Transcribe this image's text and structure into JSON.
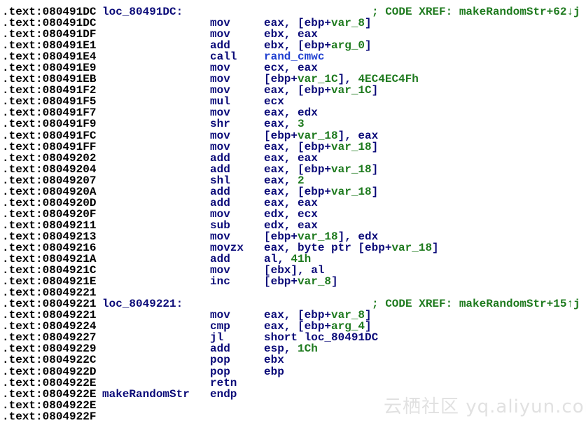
{
  "colors": {
    "address": "#000000",
    "instruction": "#0a0a78",
    "name_or_number": "#1e7a1e",
    "function_call": "#1f3fd0"
  },
  "watermark": "云栖社区 yq.aliyun.com",
  "lines": [
    {
      "addr": ".text:080491DC",
      "label": "loc_80491DC:",
      "mn": "",
      "ops": [],
      "cmt": "; CODE XREF: makeRandomStr+62↓j"
    },
    {
      "addr": ".text:080491DC",
      "label": "",
      "mn": "mov",
      "ops": [
        [
          "eax, [ebp+",
          "n"
        ],
        [
          "var_8",
          "g"
        ],
        [
          "]",
          "n"
        ]
      ],
      "cmt": ""
    },
    {
      "addr": ".text:080491DF",
      "label": "",
      "mn": "mov",
      "ops": [
        [
          "ebx, eax",
          "n"
        ]
      ],
      "cmt": ""
    },
    {
      "addr": ".text:080491E1",
      "label": "",
      "mn": "add",
      "ops": [
        [
          "ebx, [ebp+",
          "n"
        ],
        [
          "arg_0",
          "g"
        ],
        [
          "]",
          "n"
        ]
      ],
      "cmt": ""
    },
    {
      "addr": ".text:080491E4",
      "label": "",
      "mn": "call",
      "ops": [
        [
          "rand_cmwc",
          "b"
        ]
      ],
      "cmt": ""
    },
    {
      "addr": ".text:080491E9",
      "label": "",
      "mn": "mov",
      "ops": [
        [
          "ecx, eax",
          "n"
        ]
      ],
      "cmt": ""
    },
    {
      "addr": ".text:080491EB",
      "label": "",
      "mn": "mov",
      "ops": [
        [
          "[ebp+",
          "n"
        ],
        [
          "var_1C",
          "g"
        ],
        [
          "], ",
          "n"
        ],
        [
          "4EC4EC4Fh",
          "g"
        ]
      ],
      "cmt": ""
    },
    {
      "addr": ".text:080491F2",
      "label": "",
      "mn": "mov",
      "ops": [
        [
          "eax, [ebp+",
          "n"
        ],
        [
          "var_1C",
          "g"
        ],
        [
          "]",
          "n"
        ]
      ],
      "cmt": ""
    },
    {
      "addr": ".text:080491F5",
      "label": "",
      "mn": "mul",
      "ops": [
        [
          "ecx",
          "n"
        ]
      ],
      "cmt": ""
    },
    {
      "addr": ".text:080491F7",
      "label": "",
      "mn": "mov",
      "ops": [
        [
          "eax, edx",
          "n"
        ]
      ],
      "cmt": ""
    },
    {
      "addr": ".text:080491F9",
      "label": "",
      "mn": "shr",
      "ops": [
        [
          "eax, ",
          "n"
        ],
        [
          "3",
          "g"
        ]
      ],
      "cmt": ""
    },
    {
      "addr": ".text:080491FC",
      "label": "",
      "mn": "mov",
      "ops": [
        [
          "[ebp+",
          "n"
        ],
        [
          "var_18",
          "g"
        ],
        [
          "], eax",
          "n"
        ]
      ],
      "cmt": ""
    },
    {
      "addr": ".text:080491FF",
      "label": "",
      "mn": "mov",
      "ops": [
        [
          "eax, [ebp+",
          "n"
        ],
        [
          "var_18",
          "g"
        ],
        [
          "]",
          "n"
        ]
      ],
      "cmt": ""
    },
    {
      "addr": ".text:08049202",
      "label": "",
      "mn": "add",
      "ops": [
        [
          "eax, eax",
          "n"
        ]
      ],
      "cmt": ""
    },
    {
      "addr": ".text:08049204",
      "label": "",
      "mn": "add",
      "ops": [
        [
          "eax, [ebp+",
          "n"
        ],
        [
          "var_18",
          "g"
        ],
        [
          "]",
          "n"
        ]
      ],
      "cmt": ""
    },
    {
      "addr": ".text:08049207",
      "label": "",
      "mn": "shl",
      "ops": [
        [
          "eax, ",
          "n"
        ],
        [
          "2",
          "g"
        ]
      ],
      "cmt": ""
    },
    {
      "addr": ".text:0804920A",
      "label": "",
      "mn": "add",
      "ops": [
        [
          "eax, [ebp+",
          "n"
        ],
        [
          "var_18",
          "g"
        ],
        [
          "]",
          "n"
        ]
      ],
      "cmt": ""
    },
    {
      "addr": ".text:0804920D",
      "label": "",
      "mn": "add",
      "ops": [
        [
          "eax, eax",
          "n"
        ]
      ],
      "cmt": ""
    },
    {
      "addr": ".text:0804920F",
      "label": "",
      "mn": "mov",
      "ops": [
        [
          "edx, ecx",
          "n"
        ]
      ],
      "cmt": ""
    },
    {
      "addr": ".text:08049211",
      "label": "",
      "mn": "sub",
      "ops": [
        [
          "edx, eax",
          "n"
        ]
      ],
      "cmt": ""
    },
    {
      "addr": ".text:08049213",
      "label": "",
      "mn": "mov",
      "ops": [
        [
          "[ebp+",
          "n"
        ],
        [
          "var_18",
          "g"
        ],
        [
          "], edx",
          "n"
        ]
      ],
      "cmt": ""
    },
    {
      "addr": ".text:08049216",
      "label": "",
      "mn": "movzx",
      "ops": [
        [
          "eax, byte ptr [ebp+",
          "n"
        ],
        [
          "var_18",
          "g"
        ],
        [
          "]",
          "n"
        ]
      ],
      "cmt": ""
    },
    {
      "addr": ".text:0804921A",
      "label": "",
      "mn": "add",
      "ops": [
        [
          "al, ",
          "n"
        ],
        [
          "41h",
          "g"
        ]
      ],
      "cmt": ""
    },
    {
      "addr": ".text:0804921C",
      "label": "",
      "mn": "mov",
      "ops": [
        [
          "[ebx], al",
          "n"
        ]
      ],
      "cmt": ""
    },
    {
      "addr": ".text:0804921E",
      "label": "",
      "mn": "inc",
      "ops": [
        [
          "[ebp+",
          "n"
        ],
        [
          "var_8",
          "g"
        ],
        [
          "]",
          "n"
        ]
      ],
      "cmt": ""
    },
    {
      "addr": ".text:08049221",
      "label": "",
      "mn": "",
      "ops": [],
      "cmt": ""
    },
    {
      "addr": ".text:08049221",
      "label": "loc_8049221:",
      "mn": "",
      "ops": [],
      "cmt": "; CODE XREF: makeRandomStr+15↑j"
    },
    {
      "addr": ".text:08049221",
      "label": "",
      "mn": "mov",
      "ops": [
        [
          "eax, [ebp+",
          "n"
        ],
        [
          "var_8",
          "g"
        ],
        [
          "]",
          "n"
        ]
      ],
      "cmt": ""
    },
    {
      "addr": ".text:08049224",
      "label": "",
      "mn": "cmp",
      "ops": [
        [
          "eax, [ebp+",
          "n"
        ],
        [
          "arg_4",
          "g"
        ],
        [
          "]",
          "n"
        ]
      ],
      "cmt": ""
    },
    {
      "addr": ".text:08049227",
      "label": "",
      "mn": "jl",
      "ops": [
        [
          "short loc_80491DC",
          "n"
        ]
      ],
      "cmt": ""
    },
    {
      "addr": ".text:08049229",
      "label": "",
      "mn": "add",
      "ops": [
        [
          "esp, ",
          "n"
        ],
        [
          "1Ch",
          "g"
        ]
      ],
      "cmt": ""
    },
    {
      "addr": ".text:0804922C",
      "label": "",
      "mn": "pop",
      "ops": [
        [
          "ebx",
          "n"
        ]
      ],
      "cmt": ""
    },
    {
      "addr": ".text:0804922D",
      "label": "",
      "mn": "pop",
      "ops": [
        [
          "ebp",
          "n"
        ]
      ],
      "cmt": ""
    },
    {
      "addr": ".text:0804922E",
      "label": "",
      "mn": "retn",
      "ops": [],
      "cmt": ""
    },
    {
      "addr": ".text:0804922E",
      "label": "makeRandomStr",
      "mn": "endp",
      "ops": [],
      "cmt": ""
    },
    {
      "addr": ".text:0804922E",
      "label": "",
      "mn": "",
      "ops": [],
      "cmt": ""
    },
    {
      "addr": ".text:0804922F",
      "label": "",
      "mn": "",
      "ops": [],
      "cmt": ""
    }
  ]
}
